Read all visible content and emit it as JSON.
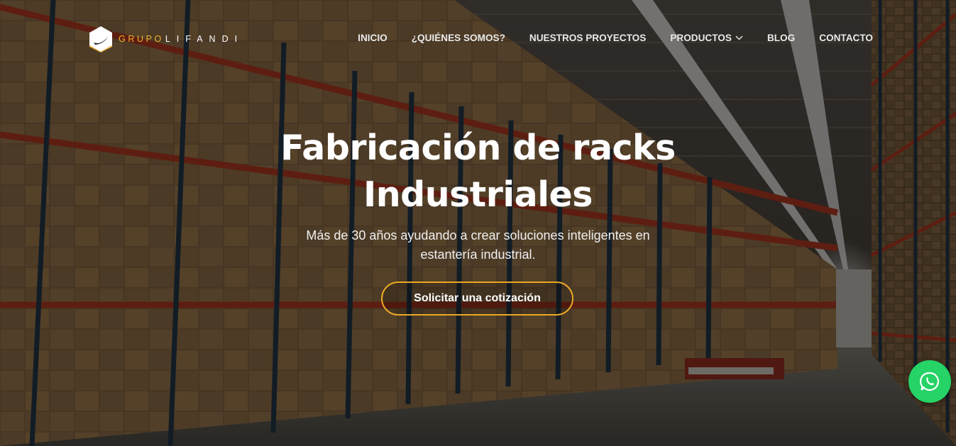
{
  "brand": {
    "name_part1": "GRUPO",
    "name_part2": "LIFANDI"
  },
  "nav": {
    "items": [
      {
        "label": "INICIO"
      },
      {
        "label": "¿QUIÉNES SOMOS?"
      },
      {
        "label": "NUESTROS PROYECTOS"
      },
      {
        "label": "PRODUCTOS",
        "has_dropdown": true
      },
      {
        "label": "BLOG"
      },
      {
        "label": "CONTACTO"
      }
    ]
  },
  "hero": {
    "title_line1": "Fabricación de racks",
    "title_line2": "Industriales",
    "subtitle": "Más de 30 años ayudando a crear soluciones inteligentes en estantería industrial.",
    "cta_label": "Solicitar una cotización"
  },
  "floating": {
    "icon": "whatsapp-icon"
  },
  "colors": {
    "accent": "#f2b02d",
    "cta_border": "#e9a825",
    "whatsapp": "#25d366",
    "rack_red": "#b8381f",
    "rack_blue": "#1d3247"
  }
}
